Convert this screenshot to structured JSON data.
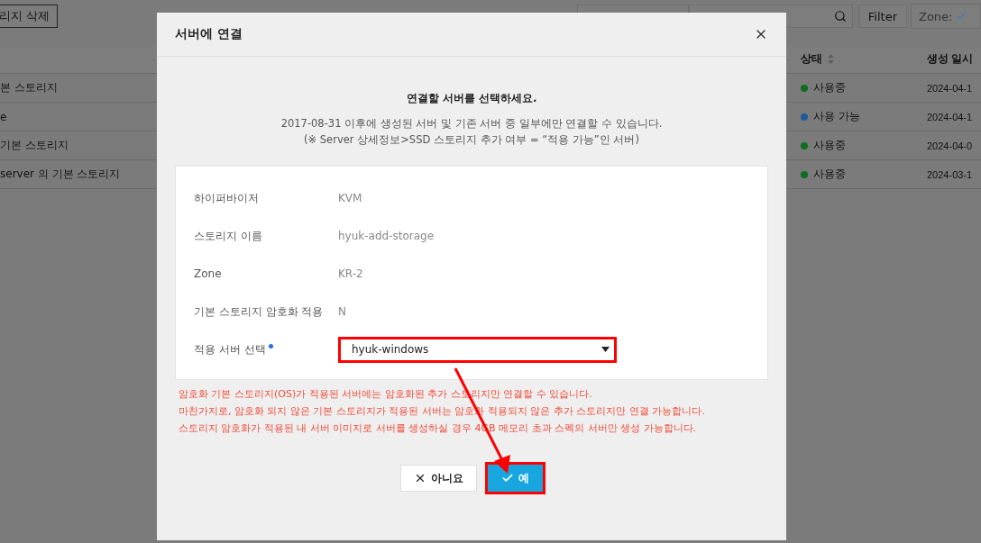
{
  "background": {
    "toolbar": {
      "delete_button": "리지 삭제",
      "filter_button": "Filter",
      "zone_label": "Zone:"
    },
    "table": {
      "columns": [
        {
          "label": "상태"
        },
        {
          "label": "생성 일시"
        }
      ],
      "rows": [
        {
          "name": "본 스토리지",
          "status": "사용중",
          "color": "#0f6e22",
          "created": "2024-04-1"
        },
        {
          "name": "e",
          "status": "사용 가능",
          "color": "#1d5c9a",
          "created": "2024-04-1"
        },
        {
          "name": "기본 스토리지",
          "status": "사용중",
          "color": "#0f6e22",
          "created": "2024-04-0"
        },
        {
          "name": "server 의 기본 스토리지",
          "status": "사용중",
          "color": "#0f6e22",
          "created": "2024-03-1"
        }
      ]
    }
  },
  "dialog": {
    "title": "서버에 연결",
    "heading": "연결할 서버를 선택하세요.",
    "notes": [
      "2017-08-31 이후에 생성된 서버 및 기존 서버 중 일부에만 연결할 수 있습니다.",
      "(※ Server 상세정보>SSD 스토리지 추가 여부 = “적용 가능”인 서버)"
    ],
    "fields": [
      {
        "kind": "text",
        "label": "하이퍼바이저",
        "value": "KVM"
      },
      {
        "kind": "text",
        "label": "스토리지 이름",
        "value": "hyuk-add-storage"
      },
      {
        "kind": "text",
        "label": "Zone",
        "value": "KR-2"
      },
      {
        "kind": "text",
        "label": "기본 스토리지 암호화 적용",
        "value": "N"
      },
      {
        "kind": "select",
        "label": "적용 서버 선택",
        "required": true,
        "value": "hyuk-windows",
        "highlighted": true
      }
    ],
    "warnings": [
      "암호화 기본 스토리지(OS)가 적용된 서버에는 암호화된 추가 스토리지만 연결할 수 있습니다.",
      "마찬가지로, 암호화 되지 않은 기본 스토리지가 적용된 서버는 암호화 적용되지 않은 추가 스토리지만 연결 가능합니다.",
      "스토리지 암호화가 적용된 내 서버 이미지로 서버를 생성하실 경우 4GB 메모리 초과 스펙의 서버만 생성 가능합니다."
    ],
    "buttons": [
      {
        "kind": "cancel",
        "label": "아니요",
        "highlighted": false
      },
      {
        "kind": "confirm",
        "label": "예",
        "highlighted": true
      }
    ]
  }
}
